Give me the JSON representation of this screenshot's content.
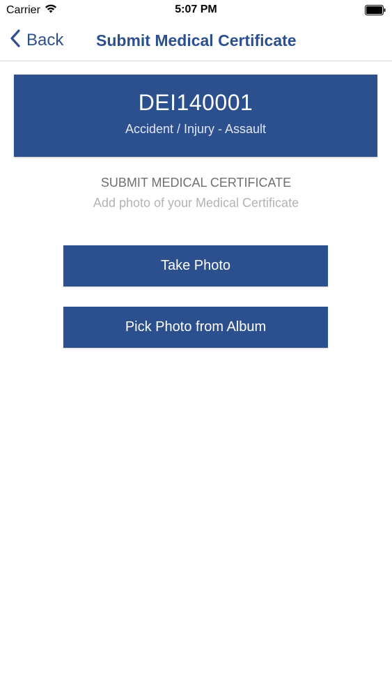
{
  "status_bar": {
    "carrier": "Carrier",
    "time": "5:07 PM"
  },
  "nav": {
    "back_label": "Back",
    "title": "Submit Medical Certificate"
  },
  "case": {
    "id": "DEI140001",
    "type": "Accident / Injury - Assault"
  },
  "section": {
    "heading": "SUBMIT MEDICAL CERTIFICATE",
    "subtitle": "Add photo of your Medical Certificate"
  },
  "actions": {
    "take_photo": "Take Photo",
    "pick_photo": "Pick Photo from Album"
  },
  "colors": {
    "brand": "#2c4f8e",
    "divider": "#d6d6d6",
    "heading_text": "#6f6f6f",
    "subtitle_text": "#b3b3b3"
  }
}
